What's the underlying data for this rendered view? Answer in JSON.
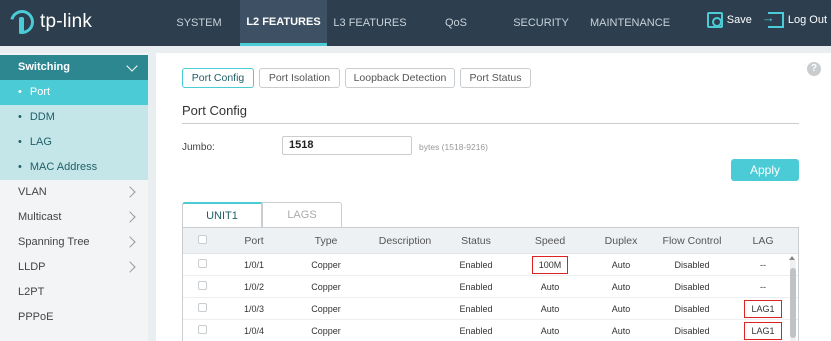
{
  "brand": {
    "logo_text": "tp-link"
  },
  "nav": {
    "items": [
      "SYSTEM",
      "L2 FEATURES",
      "L3 FEATURES",
      "QoS",
      "SECURITY",
      "MAINTENANCE"
    ],
    "active": "L2 FEATURES"
  },
  "header_actions": {
    "save": "Save",
    "logout": "Log Out"
  },
  "sidebar": {
    "group": "Switching",
    "sub_items": [
      "Port",
      "DDM",
      "LAG",
      "MAC Address"
    ],
    "items": [
      "VLAN",
      "Multicast",
      "Spanning Tree",
      "LLDP",
      "L2PT",
      "PPPoE"
    ]
  },
  "tabs": [
    "Port Config",
    "Port Isolation",
    "Loopback Detection",
    "Port Status"
  ],
  "section_title": "Port Config",
  "jumbo": {
    "label": "Jumbo:",
    "value": "1518",
    "hint": "bytes (1518-9216)"
  },
  "apply_label": "Apply",
  "unit_tabs": [
    "UNIT1",
    "LAGS"
  ],
  "table": {
    "headers": [
      "Port",
      "Type",
      "Description",
      "Status",
      "Speed",
      "Duplex",
      "Flow Control",
      "LAG"
    ],
    "rows": [
      {
        "port": "1/0/1",
        "type": "Copper",
        "description": "",
        "status": "Enabled",
        "speed": "100M",
        "duplex": "Auto",
        "flow": "Disabled",
        "lag": "--"
      },
      {
        "port": "1/0/2",
        "type": "Copper",
        "description": "",
        "status": "Enabled",
        "speed": "Auto",
        "duplex": "Auto",
        "flow": "Disabled",
        "lag": "--"
      },
      {
        "port": "1/0/3",
        "type": "Copper",
        "description": "",
        "status": "Enabled",
        "speed": "Auto",
        "duplex": "Auto",
        "flow": "Disabled",
        "lag": "LAG1"
      },
      {
        "port": "1/0/4",
        "type": "Copper",
        "description": "",
        "status": "Enabled",
        "speed": "Auto",
        "duplex": "Auto",
        "flow": "Disabled",
        "lag": "LAG1"
      }
    ]
  },
  "help_icon": "?",
  "colors": {
    "accent": "#4acbd6",
    "topbar": "#2d3e4e",
    "sidebar_group": "#2d8790",
    "highlight_box": "#dd2222"
  }
}
